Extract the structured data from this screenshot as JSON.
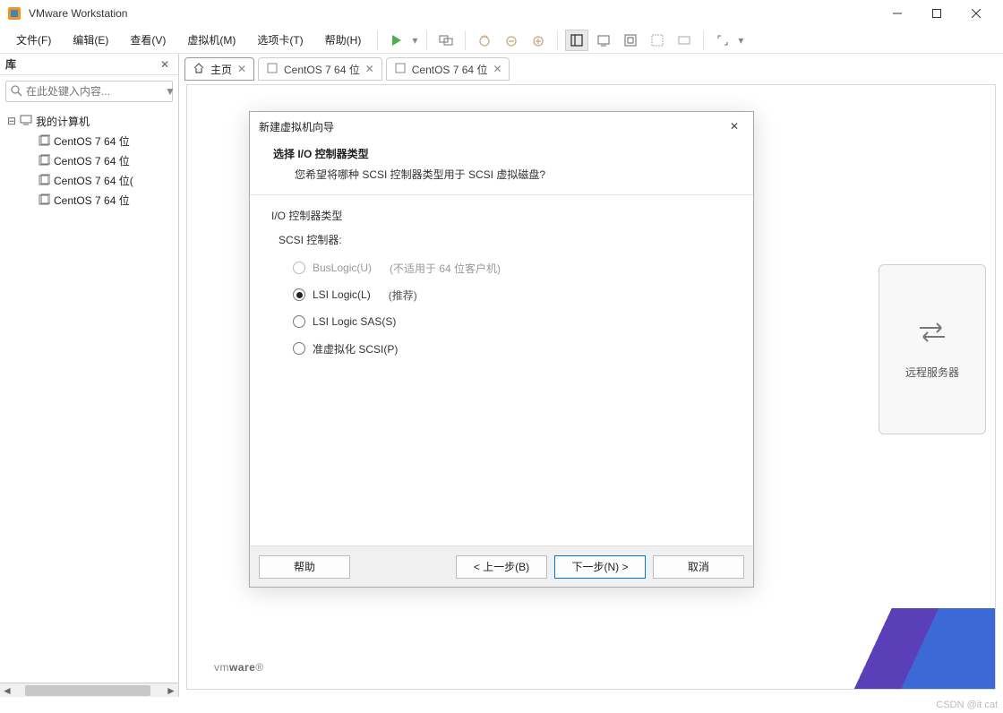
{
  "window": {
    "title": "VMware Workstation"
  },
  "menu": {
    "file": "文件(F)",
    "edit": "编辑(E)",
    "view": "查看(V)",
    "vm": "虚拟机(M)",
    "tabs": "选项卡(T)",
    "help": "帮助(H)"
  },
  "sidebar": {
    "title": "库",
    "search_placeholder": "在此处键入内容...",
    "root": "我的计算机",
    "items": [
      {
        "label": "CentOS 7 64 位"
      },
      {
        "label": "CentOS 7 64 位"
      },
      {
        "label": "CentOS 7 64 位("
      },
      {
        "label": "CentOS 7 64 位"
      }
    ]
  },
  "tabs": {
    "home": "主页",
    "t1": "CentOS 7 64 位",
    "t2": "CentOS 7 64 位"
  },
  "remote_card": {
    "label": "远程服务器"
  },
  "vmware_logo_light": "vm",
  "vmware_logo_bold": "ware",
  "dialog": {
    "title": "新建虚拟机向导",
    "heading": "选择 I/O 控制器类型",
    "subheading": "您希望将哪种 SCSI 控制器类型用于 SCSI 虚拟磁盘?",
    "group_label": "I/O 控制器类型",
    "sub_label": "SCSI 控制器:",
    "opts": {
      "buslogic": {
        "label": "BusLogic(U)",
        "note": "(不适用于 64 位客户机)"
      },
      "lsilogic": {
        "label": "LSI Logic(L)",
        "note": "(推荐)"
      },
      "lsisas": {
        "label": "LSI Logic SAS(S)"
      },
      "paravirt": {
        "label": "准虚拟化 SCSI(P)"
      }
    },
    "buttons": {
      "help": "帮助",
      "back": "< 上一步(B)",
      "next": "下一步(N) >",
      "cancel": "取消"
    }
  },
  "watermark": "CSDN @it cat"
}
